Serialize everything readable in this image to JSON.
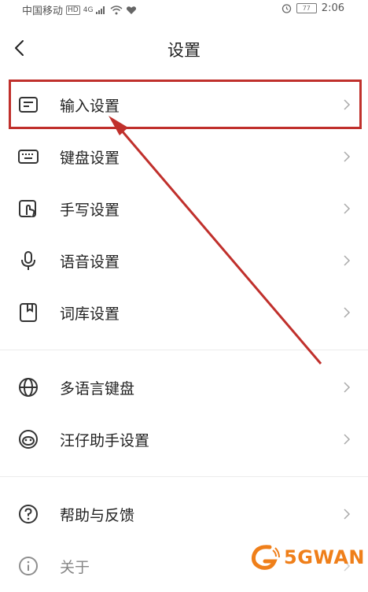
{
  "status_bar": {
    "carrier": "中国移动",
    "hd": "HD",
    "net": "4G",
    "battery": "77",
    "time": "2:06"
  },
  "header": {
    "title": "设置"
  },
  "menu": [
    {
      "label": "输入设置",
      "icon": "input-settings-icon"
    },
    {
      "label": "键盘设置",
      "icon": "keyboard-icon"
    },
    {
      "label": "手写设置",
      "icon": "handwriting-icon"
    },
    {
      "label": "语音设置",
      "icon": "microphone-icon"
    },
    {
      "label": "词库设置",
      "icon": "lexicon-icon"
    }
  ],
  "menu2": [
    {
      "label": "多语言键盘",
      "icon": "globe-icon"
    },
    {
      "label": "汪仔助手设置",
      "icon": "assistant-icon"
    }
  ],
  "menu3": [
    {
      "label": "帮助与反馈",
      "icon": "help-icon"
    },
    {
      "label": "关于",
      "icon": "info-icon"
    }
  ],
  "annotation": {
    "highlight_color": "#c0302c"
  },
  "watermark": {
    "text": "5GWAN"
  }
}
